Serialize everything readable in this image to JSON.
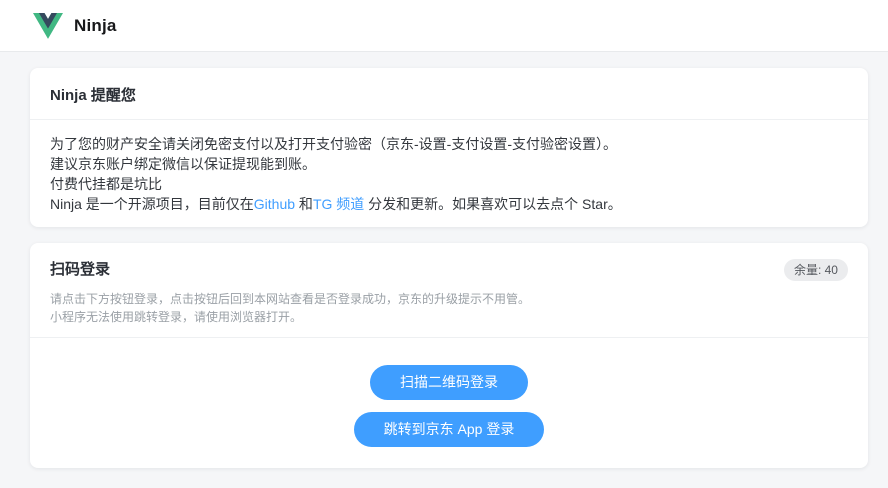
{
  "header": {
    "brand": "Ninja",
    "logo_icon": "vue-logo",
    "colors": {
      "logo_green": "#41b883",
      "logo_dark": "#35495e"
    }
  },
  "notice_card": {
    "title": "Ninja 提醒您",
    "lines": [
      "为了您的财产安全请关闭免密支付以及打开支付验密（京东-设置-支付设置-支付验密设置）。",
      "建议京东账户绑定微信以保证提现能到账。",
      "付费代挂都是坑比"
    ],
    "open_source_line": {
      "prefix": "Ninja 是一个开源项目，目前仅在",
      "github_link": "Github",
      "connector": " 和",
      "tg_link": "TG 频道",
      "suffix": " 分发和更新。如果喜欢可以去点个 Star。"
    }
  },
  "login_card": {
    "title": "扫码登录",
    "badge": "余量: 40",
    "subtitles": [
      "请点击下方按钮登录，点击按钮后回到本网站查看是否登录成功，京东的升级提示不用管。",
      "小程序无法使用跳转登录，请使用浏览器打开。"
    ],
    "buttons": [
      {
        "label": "扫描二维码登录"
      },
      {
        "label": "跳转到京东 App 登录"
      }
    ]
  },
  "colors": {
    "accent_blue": "#409eff",
    "button_blue": "#3f9eff",
    "page_bg": "#f5f6f8",
    "badge_bg": "#ebecee"
  }
}
